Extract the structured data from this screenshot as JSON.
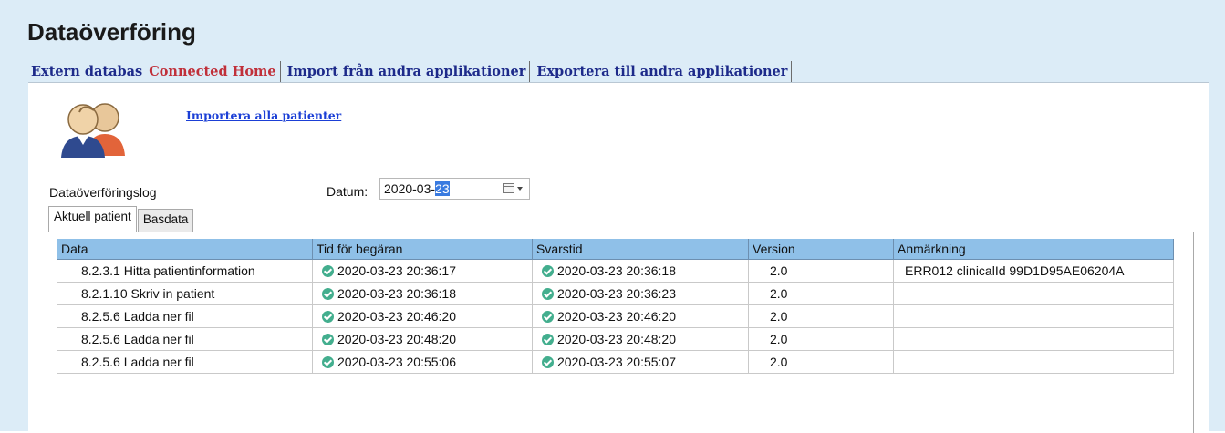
{
  "page": {
    "title": "Dataöverföring"
  },
  "tabs": [
    {
      "label": "Extern databas"
    },
    {
      "label": "Connected Home"
    },
    {
      "label": "Import från andra applikationer"
    },
    {
      "label": "Exportera till andra applikationer"
    }
  ],
  "import_link": "Importera alla patienter",
  "log_label": "Dataöverföringslog",
  "datum": {
    "label": "Datum:",
    "value_prefix": "2020-03-",
    "value_selected": "23"
  },
  "subtabs": [
    {
      "label": "Aktuell patient"
    },
    {
      "label": "Basdata"
    }
  ],
  "table": {
    "headers": [
      "Data",
      "Tid för begäran",
      "Svarstid",
      "Version",
      "Anmärkning"
    ],
    "rows": [
      {
        "data": "8.2.3.1 Hitta patientinformation",
        "request_time": "2020-03-23 20:36:17",
        "response_time": "2020-03-23 20:36:18",
        "version": "2.0",
        "remark": "ERR012 clinicalId 99D1D95AE06204A"
      },
      {
        "data": "8.2.1.10 Skriv in patient",
        "request_time": "2020-03-23 20:36:18",
        "response_time": "2020-03-23 20:36:23",
        "version": "2.0",
        "remark": ""
      },
      {
        "data": "8.2.5.6 Ladda ner fil",
        "request_time": "2020-03-23 20:46:20",
        "response_time": "2020-03-23 20:46:20",
        "version": "2.0",
        "remark": ""
      },
      {
        "data": "8.2.5.6 Ladda ner fil",
        "request_time": "2020-03-23 20:48:20",
        "response_time": "2020-03-23 20:48:20",
        "version": "2.0",
        "remark": ""
      },
      {
        "data": "8.2.5.6 Ladda ner fil",
        "request_time": "2020-03-23 20:55:06",
        "response_time": "2020-03-23 20:55:07",
        "version": "2.0",
        "remark": ""
      }
    ]
  },
  "icons": {
    "status": "check-circle-icon",
    "avatar": "patients-icon",
    "calendar": "calendar-dropdown-icon"
  },
  "colors": {
    "background": "#dcecf7",
    "header_bg": "#8fc0e8",
    "active_tab": "#c0303a",
    "tab": "#1d2a8a",
    "link": "#1b3fd6",
    "ok": "#43ae8e"
  }
}
